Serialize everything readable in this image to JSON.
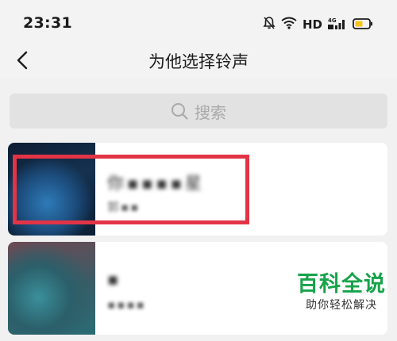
{
  "status_bar": {
    "time": "23:31",
    "hd_label": "HD",
    "network_label": "4G",
    "icons": [
      "bell-muted-icon",
      "wifi-icon",
      "signal-icon",
      "battery-icon"
    ],
    "battery_color": "#f5c518"
  },
  "header": {
    "title": "为他选择铃声",
    "back_icon": "chevron-left-icon"
  },
  "search": {
    "placeholder": "搜索",
    "icon": "search-icon"
  },
  "songs": [
    {
      "title": "你▪▪▪▪星",
      "artist": "郭▪▪"
    },
    {
      "title": "▪",
      "artist": "▪▪▪▪"
    }
  ],
  "annotation": {
    "color": "#e23446"
  },
  "watermark": {
    "main": "百科全说",
    "sub": "助你轻松解决",
    "color": "#16a34a"
  }
}
